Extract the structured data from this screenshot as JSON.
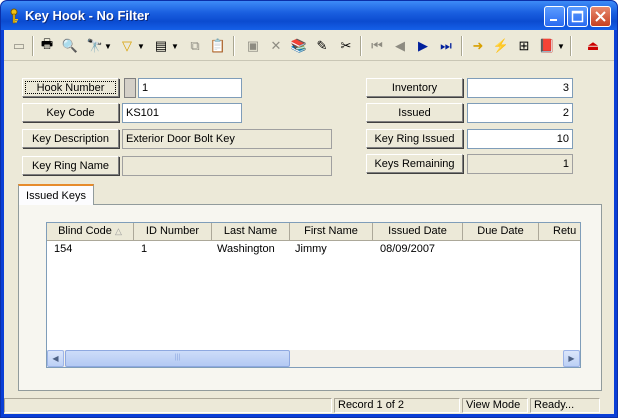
{
  "window": {
    "title": "Key Hook - No Filter",
    "title_icon": "key-icon",
    "controls": [
      "minimize-icon",
      "maximize-icon",
      "close-icon"
    ]
  },
  "toolbar": {
    "icons": [
      "new-icon",
      "print-icon",
      "print-preview-icon",
      "find-icon",
      "filter-icon",
      "report-icon",
      "copy-icon",
      "paste-icon",
      "save-icon",
      "delete-icon",
      "add-record-icon",
      "edit-icon",
      "cut-icon",
      "first-record-icon",
      "previous-record-icon",
      "next-record-icon",
      "last-record-icon",
      "go-icon",
      "lightning-icon",
      "lookup-icon",
      "books-icon",
      "exit-icon"
    ]
  },
  "form": {
    "hook_number_label": "Hook Number",
    "hook_number_value": "1",
    "key_code_label": "Key Code",
    "key_code_value": "KS101",
    "key_description_label": "Key Description",
    "key_description_value": "Exterior Door Bolt Key",
    "key_ring_name_label": "Key Ring Name",
    "key_ring_name_value": "",
    "inventory_label": "Inventory",
    "inventory_value": "3",
    "issued_label": "Issued",
    "issued_value": "2",
    "key_ring_issued_label": "Key Ring Issued",
    "key_ring_issued_value": "10",
    "keys_remaining_label": "Keys Remaining",
    "keys_remaining_value": "1"
  },
  "tabs": {
    "issued_keys": "Issued Keys"
  },
  "grid": {
    "columns": [
      "Blind Code",
      "ID Number",
      "Last Name",
      "First Name",
      "Issued Date",
      "Due Date",
      "Retu"
    ],
    "sort_indicator": "△",
    "rows": [
      [
        "154",
        "1",
        "Washington",
        "Jimmy",
        "08/09/2007",
        "",
        ""
      ]
    ]
  },
  "status": {
    "record": "Record 1 of 2",
    "mode": "View Mode",
    "state": "Ready..."
  },
  "colors": {
    "title_bar": "#0b4bd0",
    "face": "#ece9d8",
    "close_button": "#c64021"
  }
}
